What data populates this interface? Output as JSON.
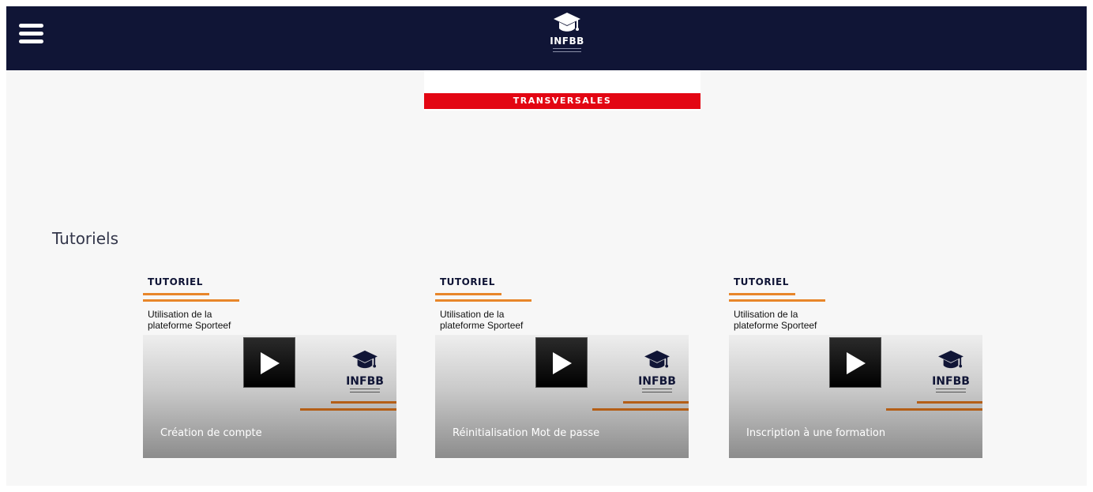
{
  "header": {
    "menu_icon": "hamburger-menu-icon",
    "logo_icon": "graduation-cap-icon",
    "logo_text": "INFBB",
    "colors": {
      "navy": "#101536",
      "accent_red": "#e30613",
      "accent_orange": "#e8862a"
    }
  },
  "banner": {
    "label": "TRANSVERSALES"
  },
  "tutorials": {
    "title": "Tutoriels",
    "cards": [
      {
        "kicker": "TUTORIEL",
        "subtitle_line1": "Utilisation de la",
        "subtitle_line2": "plateforme Sporteef",
        "caption": "Création de compte",
        "thumb_logo": "INFBB",
        "play_icon": "play-icon"
      },
      {
        "kicker": "TUTORIEL",
        "subtitle_line1": "Utilisation de la",
        "subtitle_line2": "plateforme Sporteef",
        "caption": "Réinitialisation Mot de passe",
        "thumb_logo": "INFBB",
        "play_icon": "play-icon"
      },
      {
        "kicker": "TUTORIEL",
        "subtitle_line1": "Utilisation de la",
        "subtitle_line2": "plateforme Sporteef",
        "caption": "Inscription à une formation",
        "thumb_logo": "INFBB",
        "play_icon": "play-icon"
      }
    ]
  }
}
